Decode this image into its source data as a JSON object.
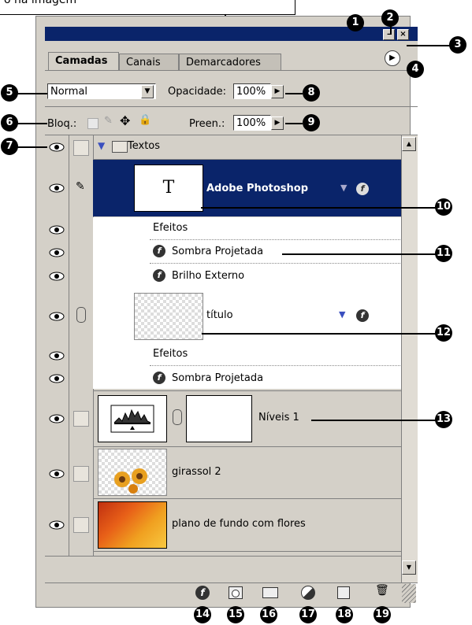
{
  "callout": {
    "text": "o na imagem"
  },
  "tabs": [
    {
      "label": "Camadas"
    },
    {
      "label": "Canais"
    },
    {
      "label": "Demarcadores"
    }
  ],
  "blend": {
    "value": "Normal"
  },
  "opacity": {
    "label": "Opacidade:",
    "value": "100%"
  },
  "lock": {
    "label": "Bloq.:"
  },
  "fill": {
    "label": "Preen.:",
    "value": "100%"
  },
  "layers": {
    "group": "Textos",
    "text_layer": {
      "thumb": "T",
      "name": "Adobe Photoshop"
    },
    "effects_label": "Efeitos",
    "fx1": "Sombra Projetada",
    "fx2": "Brilho Externo",
    "titulo": "título",
    "effects_label2": "Efeitos",
    "fx3": "Sombra Projetada",
    "niveis": "Níveis 1",
    "girassol": "girassol 2",
    "fundo": "plano de fundo com flores"
  },
  "callouts": [
    "1",
    "2",
    "3",
    "4",
    "5",
    "6",
    "7",
    "8",
    "9",
    "10",
    "11",
    "12",
    "13",
    "14",
    "15",
    "16",
    "17",
    "18",
    "19"
  ],
  "colors": {
    "titlebar": "#0a246a",
    "selected": "#0a246a",
    "panel": "#d4d0c8"
  }
}
